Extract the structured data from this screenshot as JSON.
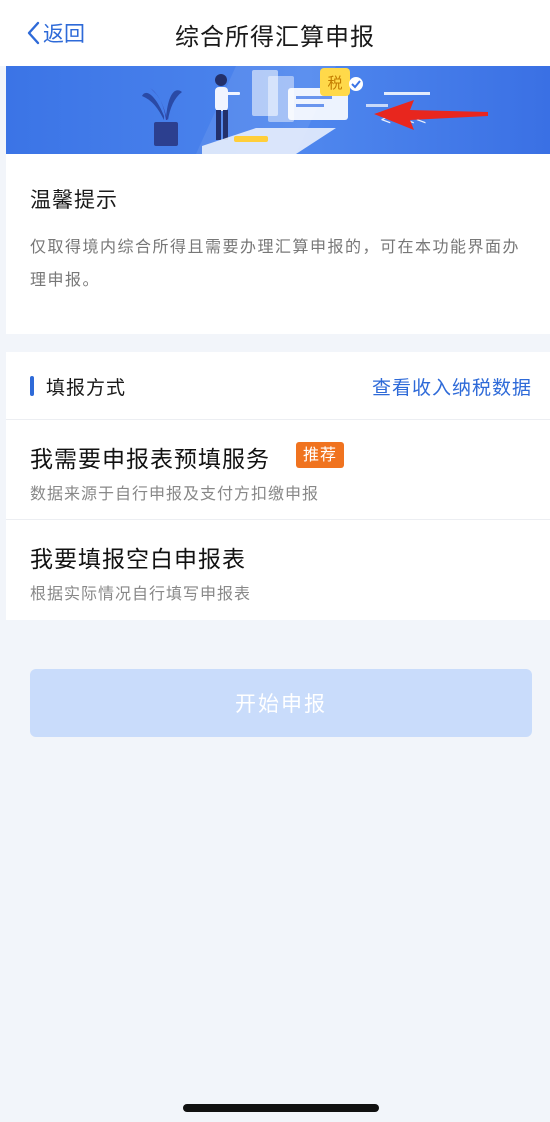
{
  "navbar": {
    "back_label": "返回",
    "title": "综合所得汇算申报"
  },
  "banner": {
    "tax_badge": "税",
    "accent_color": "#3b74e6"
  },
  "tips": {
    "title": "温馨提示",
    "body": "仅取得境内综合所得且需要办理汇算申报的，可在本功能界面办理申报。"
  },
  "method": {
    "title": "填报方式",
    "link": "查看收入纳税数据",
    "options": [
      {
        "title": "我需要申报表预填服务",
        "badge": "推荐",
        "subtitle": "数据来源于自行申报及支付方扣缴申报"
      },
      {
        "title": "我要填报空白申报表",
        "subtitle": "根据实际情况自行填写申报表"
      }
    ]
  },
  "start_button": {
    "label": "开始申报",
    "state": "disabled"
  },
  "colors": {
    "primary": "#2e6ad8",
    "badge": "#f0731f",
    "arrow": "#e8261e",
    "disabled_button": "#c9dcfb"
  }
}
